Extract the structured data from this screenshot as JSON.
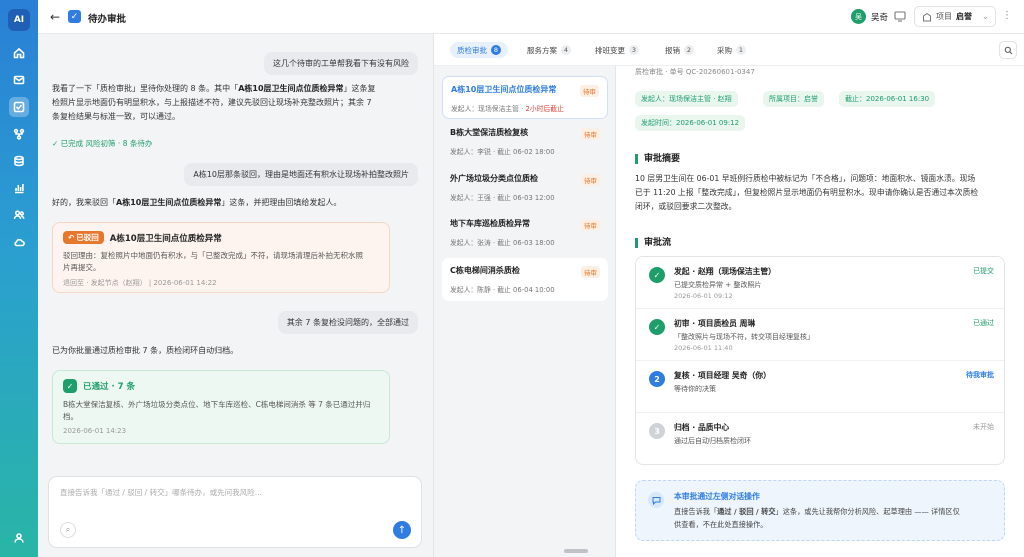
{
  "app": {
    "logo": "AI",
    "back_icon": "arrow-left-icon",
    "page_icon": "checkbox-icon",
    "title": "待办审批"
  },
  "user": {
    "avatar": "吴",
    "name": "吴奇"
  },
  "project": {
    "label": "项目",
    "value": "启誉"
  },
  "rail": {
    "items": [
      "home-icon",
      "inbox-icon",
      "approval-icon",
      "flow-icon",
      "database-icon",
      "chart-icon",
      "people-icon",
      "cloud-icon",
      "user-icon"
    ],
    "active": 2
  },
  "chat": {
    "u1": "这几个待审的工单帮我看下有没有风险",
    "a1_l1a": "我看了一下「质检审批」里待你处理的 8 条。其中「",
    "a1_l1b": "A栋10层卫生间点位质检异常",
    "a1_l1c": "」这条复",
    "a1_l2": "检照片显示地面仍有明显积水，与上报描述不符，建议先驳回让现场补充整改照片；其余 7",
    "a1_l3": "条复检结果与标准一致，可以通过。",
    "done": "✓ 已完成 风险初筛 · 8 条待办",
    "u2": "A栋10层那条驳回，理由是地面还有积水让现场补拍整改照片",
    "a2a": "好的，我来驳回「",
    "a2b": "A栋10层卫生间点位质检异常",
    "a2c": "」这条，并把理由回填给发起人。",
    "rej_tag": "已驳回",
    "rej_title": "A栋10层卫生间点位质检异常",
    "rej_b1": "驳回理由：复检照片中地面仍有积水，与「已整改完成」不符，请现场清理后补拍无积水照",
    "rej_b2": "片再提交。",
    "rej_meta": "退回至 · 发起节点（赵翔）  |  2026-06-01 14:22",
    "u3": "其余 7 条复检没问题的，全部通过",
    "a3": "已为你批量通过质检审批 7 条，质检闭环自动归档。",
    "ok_title": "已通过 · 7 条",
    "ok_b1": "B栋大堂保洁复核、外广场垃圾分类点位、地下车库巡检、C栋电梯间消杀 等 7 条已通过并归",
    "ok_b2": "档。",
    "ok_meta": "2026-06-01 14:23",
    "placeholder": "直接告诉我「通过 / 驳回 / 转交」哪条待办，或先问我风险…"
  },
  "tabs": [
    {
      "label": "质检审批",
      "count": "8"
    },
    {
      "label": "服务方案",
      "count": "4"
    },
    {
      "label": "排班变更",
      "count": "3"
    },
    {
      "label": "报销",
      "count": "2"
    },
    {
      "label": "采购",
      "count": "1"
    }
  ],
  "list": [
    {
      "title": "A栋10层卫生间点位质检异常",
      "badge": "待审",
      "sub": "发起人：现场保洁主管 · ",
      "due": "2小时后截止"
    },
    {
      "title": "B栋大堂保洁质检复核",
      "badge": "待审",
      "sub": "发起人：李锐 · 截止 06-02 18:00"
    },
    {
      "title": "外广场垃圾分类点位质检",
      "badge": "待审",
      "sub": "发起人：王强 · 截止 06-03 12:00"
    },
    {
      "title": "地下车库巡检质检异常",
      "badge": "待审",
      "sub": "发起人：张涛 · 截止 06-03 18:00"
    },
    {
      "title": "C栋电梯间消杀质检",
      "badge": "待审",
      "sub": "发起人：陈静 · 截止 06-04 10:00"
    }
  ],
  "detail": {
    "number": "质检审批 · 单号 QC-20260601-0347",
    "pills": [
      "发起人：现场保洁主管 · 赵翔",
      "所属项目：启誉",
      "截止：2026-06-01 16:30",
      "发起时间：2026-06-01 09:12"
    ],
    "summary_title": "审批摘要",
    "summary_l1": "10 层男卫生间在 06-01 早班例行质检中被标记为「不合格」，问题项：地面积水、镜面水渍。现场",
    "summary_l2": "已于 11:20 上报「整改完成」，但复检照片显示地面仍有明显积水。现申请你确认是否通过本次质检",
    "summary_l3": "闭环，或驳回要求二次整改。",
    "flow_title": "审批流",
    "steps": [
      {
        "icon": "✓",
        "title": "发起 · 赵翔（现场保洁主管）",
        "desc": "已提交质检异常 + 整改照片",
        "time": "2026-06-01 09:12",
        "status": "已提交",
        "status_color": "#1e9e6a"
      },
      {
        "icon": "✓",
        "title": "初审 · 项目质检员 周琳",
        "desc": "「整改照片与现场不符，转交项目经理复核」",
        "time": "2026-06-01 11:40",
        "status": "已通过",
        "status_color": "#1e9e6a"
      },
      {
        "icon": "2",
        "title": "复核 · 项目经理 吴奇（你）",
        "desc": "等待你的决策",
        "time": "",
        "status": "待我审批",
        "status_color": "#2f7de1"
      },
      {
        "icon": "3",
        "title": "归档 · 品质中心",
        "desc": "通过后自动归档质检闭环",
        "time": "",
        "status": "未开始",
        "status_color": "#999999"
      }
    ],
    "tip_title": "本审批通过左侧对话操作",
    "tip_l1a": "直接告诉我「",
    "tip_l1b": "通过 / 驳回 / 转交",
    "tip_l1c": "」这条，或先让我帮你分析风险、起草理由 —— 详情区仅",
    "tip_l2": "供查看，不在此处直接操作。"
  }
}
